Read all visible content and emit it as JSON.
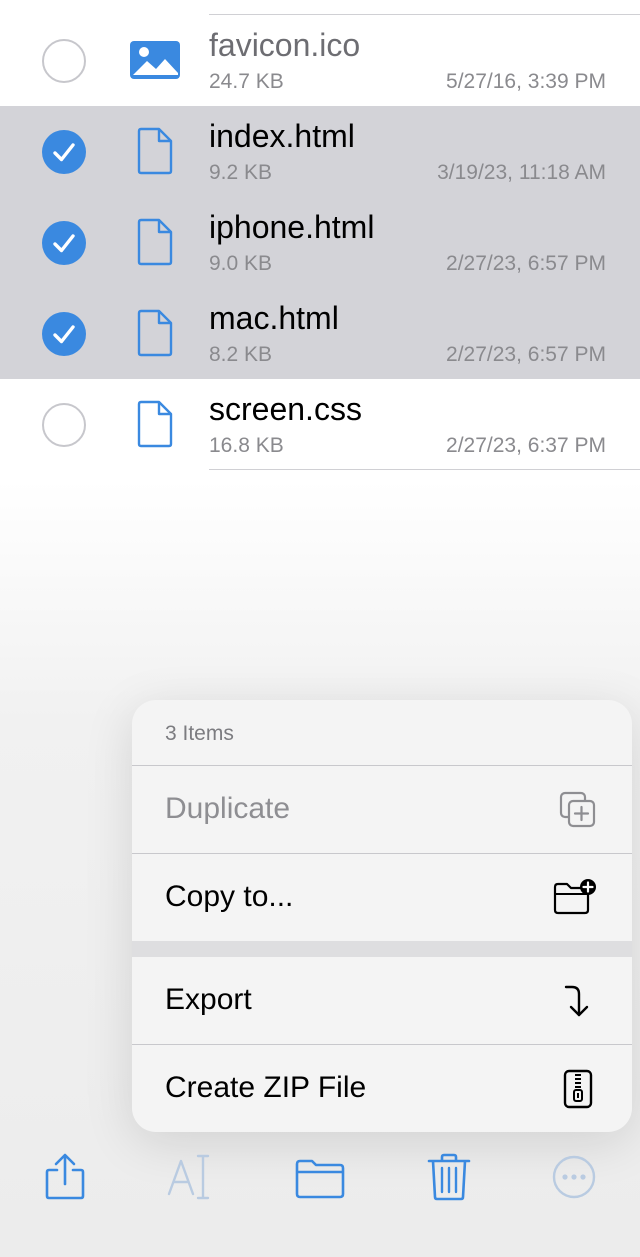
{
  "files": [
    {
      "name": "favicon.ico",
      "size": "24.7 KB",
      "date": "5/27/16, 3:39 PM",
      "selected": false,
      "icon": "image-icon"
    },
    {
      "name": "index.html",
      "size": "9.2 KB",
      "date": "3/19/23, 11:18 AM",
      "selected": true,
      "icon": "document-icon"
    },
    {
      "name": "iphone.html",
      "size": "9.0 KB",
      "date": "2/27/23, 6:57 PM",
      "selected": true,
      "icon": "document-icon"
    },
    {
      "name": "mac.html",
      "size": "8.2 KB",
      "date": "2/27/23, 6:57 PM",
      "selected": true,
      "icon": "document-icon"
    },
    {
      "name": "screen.css",
      "size": "16.8 KB",
      "date": "2/27/23, 6:37 PM",
      "selected": false,
      "icon": "document-icon"
    }
  ],
  "context_menu": {
    "header": "3 Items",
    "items": [
      {
        "label": "Duplicate",
        "icon": "duplicate-icon",
        "enabled": false
      },
      {
        "label": "Copy to...",
        "icon": "folder-add-icon",
        "enabled": true
      },
      {
        "label": "Export",
        "icon": "export-arrow-icon",
        "enabled": true
      },
      {
        "label": "Create ZIP File",
        "icon": "zip-file-icon",
        "enabled": true
      }
    ]
  },
  "toolbar": {
    "items": [
      "share-icon",
      "rename-icon",
      "folder-icon",
      "trash-icon",
      "more-icon"
    ]
  },
  "colors": {
    "accent": "#3a89e0",
    "selected_row": "#d3d3d8",
    "secondary_text": "#8a8a8e"
  }
}
